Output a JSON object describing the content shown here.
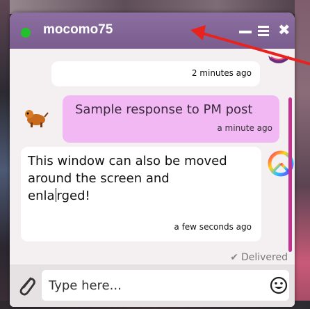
{
  "chat": {
    "username": "mocomo75",
    "presence_color": "#22c02a",
    "header_color": "#7a5d8f"
  },
  "messages": [
    {
      "text": "",
      "time": "2 minutes ago",
      "avatar": "avatar-icon"
    },
    {
      "text": "Sample response to PM post",
      "time": "a minute ago",
      "avatar": "dog-avatar-icon",
      "bubble_color": "#f2b8f3"
    },
    {
      "text_line1": "This window can also be moved",
      "text_line2": "around the screen and",
      "text_line3a": "enla",
      "text_line3b": "rged!",
      "time": "a few seconds ago",
      "avatar": "peace-sign-avatar-icon"
    }
  ],
  "status": {
    "delivered": "Delivered"
  },
  "composer": {
    "placeholder": "Type here..."
  },
  "icons": {
    "attach": "paperclip-icon",
    "emoji": "smiley-icon",
    "minimize": "minimize-icon",
    "menu": "menu-icon",
    "close": "close-icon"
  },
  "colors": {
    "accent": "#c2338f",
    "annotation_arrow": "#e8231f"
  }
}
